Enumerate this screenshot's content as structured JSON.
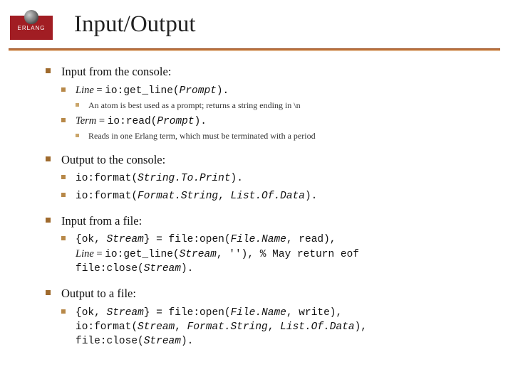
{
  "logo": {
    "label": "ERLANG"
  },
  "title": "Input/Output",
  "sections": [
    {
      "heading": "Input from the console:",
      "items": [
        {
          "line": [
            {
              "t": "Line",
              "style": "ital"
            },
            {
              "t": " = ",
              "style": ""
            },
            {
              "t": "io:get_line(",
              "style": "code"
            },
            {
              "t": "Prompt",
              "style": "code ital"
            },
            {
              "t": ").",
              "style": "code"
            }
          ],
          "sub": [
            {
              "text": "An atom is best used as a prompt; returns a string ending in \\n"
            }
          ]
        },
        {
          "line": [
            {
              "t": "Term",
              "style": "ital"
            },
            {
              "t": " = ",
              "style": ""
            },
            {
              "t": "io:read(",
              "style": "code"
            },
            {
              "t": "Prompt",
              "style": "code ital"
            },
            {
              "t": ").",
              "style": "code"
            }
          ],
          "sub": [
            {
              "text": "Reads in one Erlang term, which must be terminated with a period"
            }
          ]
        }
      ]
    },
    {
      "heading": "Output to the console:",
      "items": [
        {
          "line": [
            {
              "t": "io:format(",
              "style": "code"
            },
            {
              "t": "String.To.Print",
              "style": "code ital"
            },
            {
              "t": ").",
              "style": "code"
            }
          ]
        },
        {
          "line": [
            {
              "t": "io:format(",
              "style": "code"
            },
            {
              "t": "Format.String",
              "style": "code ital"
            },
            {
              "t": ", ",
              "style": "code"
            },
            {
              "t": "List.Of.Data",
              "style": "code ital"
            },
            {
              "t": ").",
              "style": "code"
            }
          ]
        }
      ]
    },
    {
      "heading": "Input from a file:",
      "items": [
        {
          "line": [
            {
              "t": "{ok, ",
              "style": "code"
            },
            {
              "t": "Stream",
              "style": "code ital"
            },
            {
              "t": "} = file:open(",
              "style": "code"
            },
            {
              "t": "File.Name",
              "style": "code ital"
            },
            {
              "t": ", read),\n",
              "style": "code"
            },
            {
              "t": "Line",
              "style": "ital"
            },
            {
              "t": " = ",
              "style": ""
            },
            {
              "t": "io:get_line(",
              "style": "code"
            },
            {
              "t": "Stream",
              "style": "code ital"
            },
            {
              "t": ", ''), % May return eof\n",
              "style": "code"
            },
            {
              "t": "file:close(",
              "style": "code"
            },
            {
              "t": "Stream",
              "style": "code ital"
            },
            {
              "t": ").",
              "style": "code"
            }
          ]
        }
      ]
    },
    {
      "heading": "Output to a file:",
      "items": [
        {
          "line": [
            {
              "t": "{ok, ",
              "style": "code"
            },
            {
              "t": "Stream",
              "style": "code ital"
            },
            {
              "t": "} = file:open(",
              "style": "code"
            },
            {
              "t": "File.Name",
              "style": "code ital"
            },
            {
              "t": ", write),\n",
              "style": "code"
            },
            {
              "t": "io:format(",
              "style": "code"
            },
            {
              "t": "Stream",
              "style": "code ital"
            },
            {
              "t": ", ",
              "style": "code"
            },
            {
              "t": "Format.String",
              "style": "code ital"
            },
            {
              "t": ", ",
              "style": "code"
            },
            {
              "t": "List.Of.Data",
              "style": "code ital"
            },
            {
              "t": "),\n",
              "style": "code"
            },
            {
              "t": "file:close(",
              "style": "code"
            },
            {
              "t": "Stream",
              "style": "code ital"
            },
            {
              "t": ").",
              "style": "code"
            }
          ]
        }
      ]
    }
  ]
}
